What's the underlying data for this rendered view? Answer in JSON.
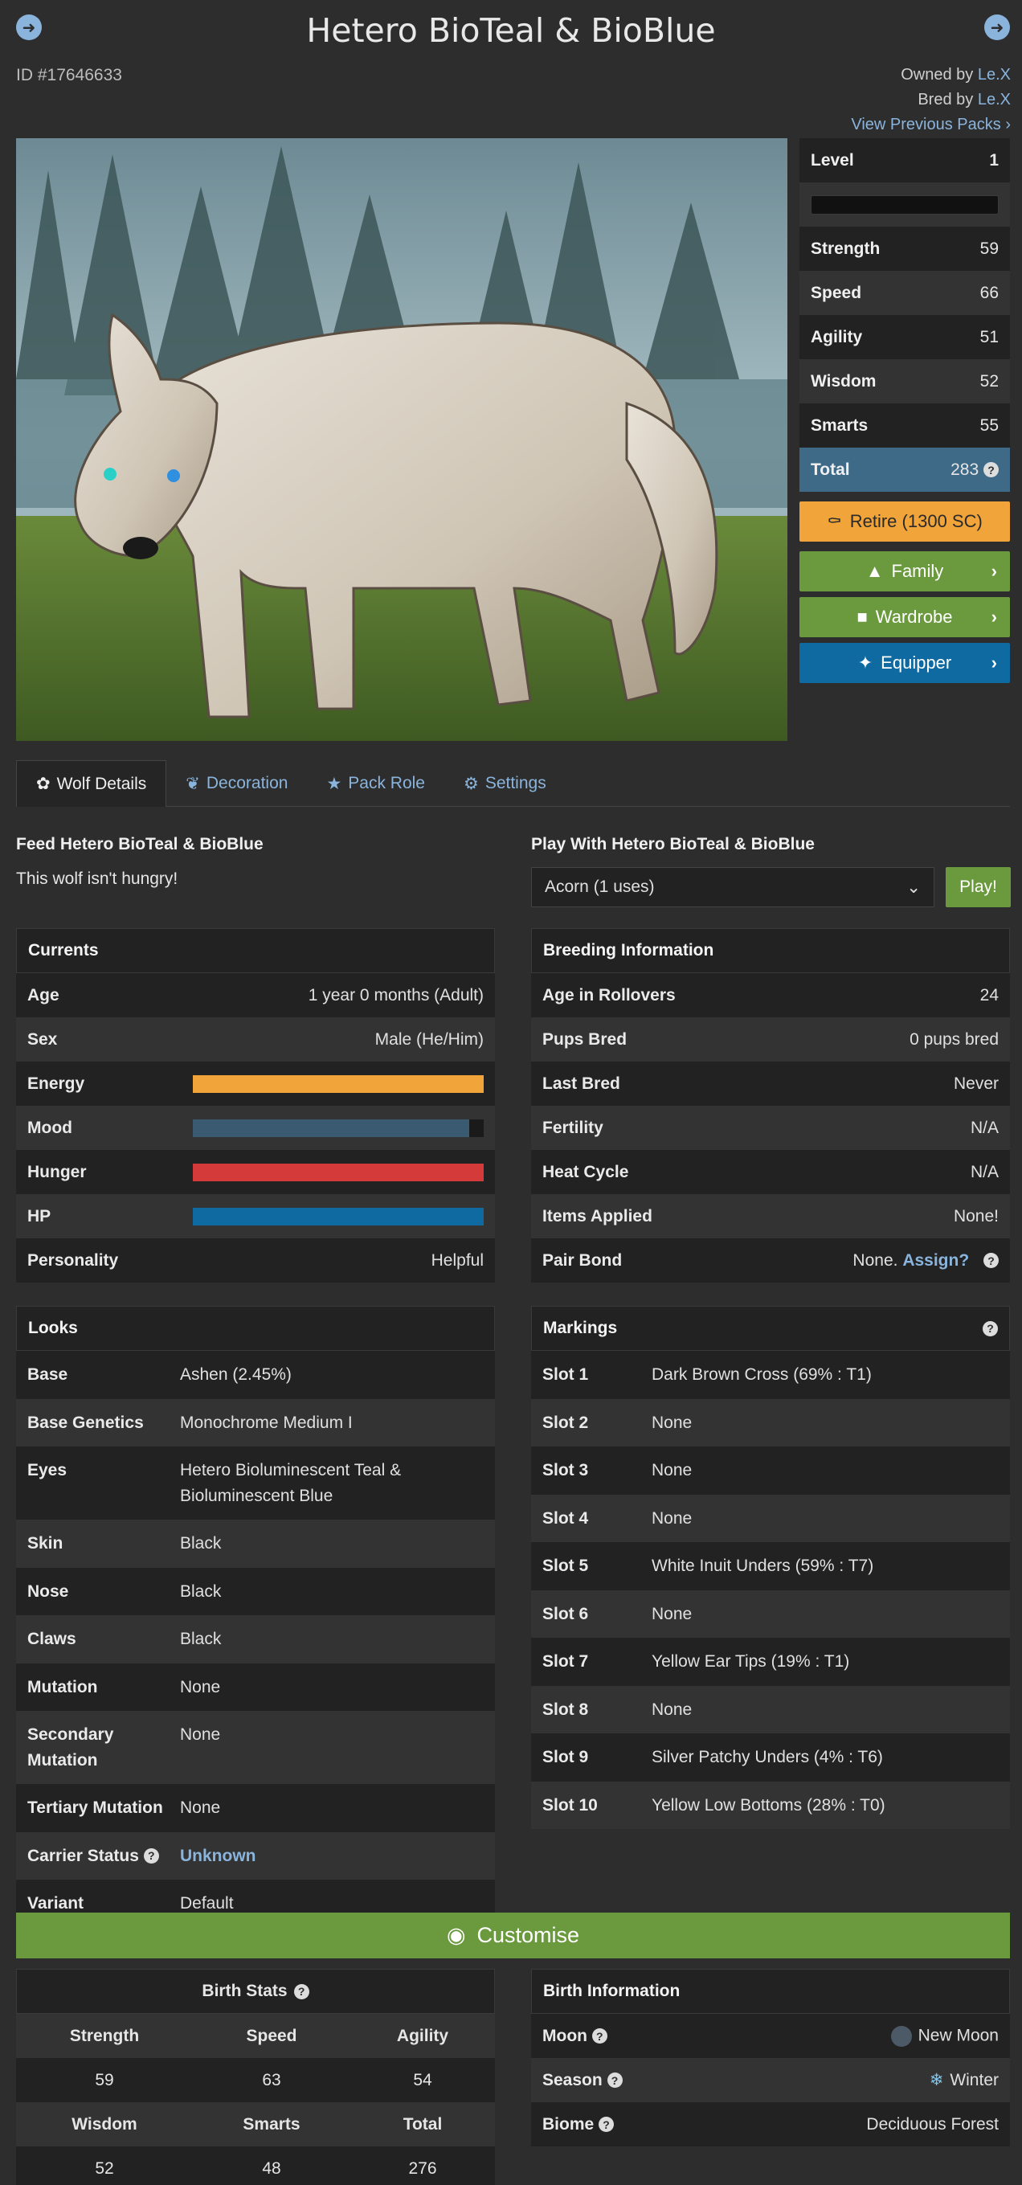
{
  "header": {
    "title": "Hetero BioTeal & BioBlue",
    "id_text": "ID #17646633",
    "owned_prefix": "Owned by",
    "owner": "Le.X",
    "bred_prefix": "Bred by",
    "breeder": "Le.X",
    "view_previous": "View Previous Packs",
    "prev_icon": "arrow-left-icon",
    "next_icon": "arrow-right-icon"
  },
  "stats": {
    "level_label": "Level",
    "level_value": "1",
    "xp_fraction": 0,
    "rows": [
      {
        "label": "Strength",
        "value": "59"
      },
      {
        "label": "Speed",
        "value": "66"
      },
      {
        "label": "Agility",
        "value": "51"
      },
      {
        "label": "Wisdom",
        "value": "52"
      },
      {
        "label": "Smarts",
        "value": "55"
      }
    ],
    "total_label": "Total",
    "total_value": "283"
  },
  "actions": {
    "retire": "Retire (1300 SC)",
    "family": "Family",
    "wardrobe": "Wardrobe",
    "equipper": "Equipper",
    "colors": {
      "retire": "#f0a43a",
      "green": "#6b9a3e",
      "blue": "#0e6aa0"
    }
  },
  "tabs": [
    {
      "label": "Wolf Details",
      "icon": "paw-icon"
    },
    {
      "label": "Decoration",
      "icon": "feather-icon"
    },
    {
      "label": "Pack Role",
      "icon": "star-icon"
    },
    {
      "label": "Settings",
      "icon": "gear-icon"
    }
  ],
  "feed": {
    "title": "Feed Hetero BioTeal & BioBlue",
    "message": "This wolf isn't hungry!"
  },
  "play": {
    "title": "Play With Hetero BioTeal & BioBlue",
    "selected": "Acorn (1 uses)",
    "button": "Play!"
  },
  "currents": {
    "title": "Currents",
    "age_label": "Age",
    "age_value": "1 year 0 months (Adult)",
    "sex_label": "Sex",
    "sex_value": "Male (He/Him)",
    "energy_label": "Energy",
    "energy_fraction": 1.0,
    "energy_color": "#f0a43a",
    "mood_label": "Mood",
    "mood_fraction": 0.95,
    "mood_color": "#3a5a72",
    "hunger_label": "Hunger",
    "hunger_fraction": 1.0,
    "hunger_color": "#d43a3a",
    "hp_label": "HP",
    "hp_fraction": 1.0,
    "hp_color": "#0e6aa0",
    "personality_label": "Personality",
    "personality_value": "Helpful"
  },
  "breeding": {
    "title": "Breeding Information",
    "rows": [
      {
        "label": "Age in Rollovers",
        "value": "24"
      },
      {
        "label": "Pups Bred",
        "value": "0 pups bred"
      },
      {
        "label": "Last Bred",
        "value": "Never"
      },
      {
        "label": "Fertility",
        "value": "N/A"
      },
      {
        "label": "Heat Cycle",
        "value": "N/A"
      },
      {
        "label": "Items Applied",
        "value": "None!"
      }
    ],
    "pair_label": "Pair Bond",
    "pair_value": "None.",
    "pair_link": "Assign?"
  },
  "looks": {
    "title": "Looks",
    "rows": [
      {
        "label": "Base",
        "value": "Ashen (2.45%)"
      },
      {
        "label": "Base Genetics",
        "value": "Monochrome Medium I"
      },
      {
        "label": "Eyes",
        "value": "Hetero Bioluminescent Teal & Bioluminescent Blue"
      },
      {
        "label": "Skin",
        "value": "Black"
      },
      {
        "label": "Nose",
        "value": "Black"
      },
      {
        "label": "Claws",
        "value": "Black"
      },
      {
        "label": "Mutation",
        "value": "None"
      },
      {
        "label": "Secondary Mutation",
        "value": "None"
      },
      {
        "label": "Tertiary Mutation",
        "value": "None"
      }
    ],
    "carrier_label": "Carrier Status",
    "carrier_value": "Unknown",
    "variant_label": "Variant",
    "variant_value": "Default"
  },
  "markings": {
    "title": "Markings",
    "rows": [
      {
        "label": "Slot 1",
        "value": "Dark Brown Cross (69% : T1)"
      },
      {
        "label": "Slot 2",
        "value": "None"
      },
      {
        "label": "Slot 3",
        "value": "None"
      },
      {
        "label": "Slot 4",
        "value": "None"
      },
      {
        "label": "Slot 5",
        "value": "White Inuit Unders (59% : T7)"
      },
      {
        "label": "Slot 6",
        "value": "None"
      },
      {
        "label": "Slot 7",
        "value": "Yellow Ear Tips (19% : T1)"
      },
      {
        "label": "Slot 8",
        "value": "None"
      },
      {
        "label": "Slot 9",
        "value": "Silver Patchy Unders (4% : T6)"
      },
      {
        "label": "Slot 10",
        "value": "Yellow Low Bottoms (28% : T0)"
      }
    ]
  },
  "customise": {
    "label": "Customise",
    "icon": "palette-icon"
  },
  "birth_stats": {
    "title": "Birth Stats",
    "h1": [
      "Strength",
      "Speed",
      "Agility"
    ],
    "v1": [
      "59",
      "63",
      "54"
    ],
    "h2": [
      "Wisdom",
      "Smarts",
      "Total"
    ],
    "v2": [
      "52",
      "48",
      "276"
    ]
  },
  "birth_info": {
    "title": "Birth Information",
    "moon_label": "Moon",
    "moon_value": "New Moon",
    "season_label": "Season",
    "season_value": "Winter",
    "biome_label": "Biome",
    "biome_value": "Deciduous Forest"
  }
}
